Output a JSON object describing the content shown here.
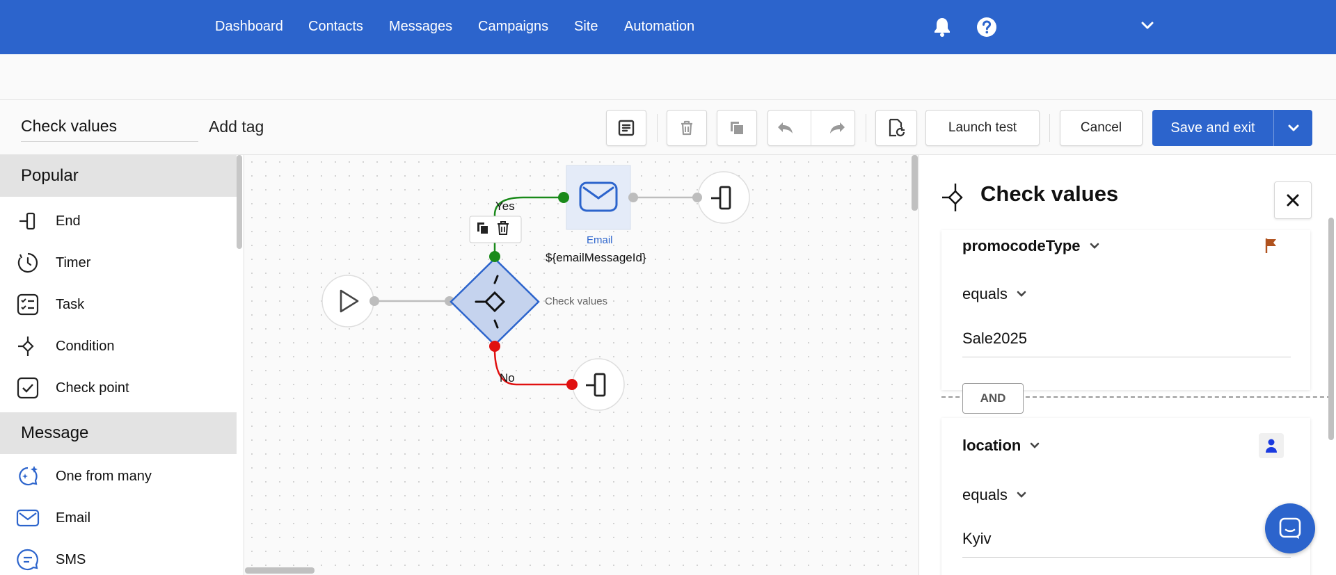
{
  "nav": {
    "items": [
      "Dashboard",
      "Contacts",
      "Messages",
      "Campaigns",
      "Site",
      "Automation"
    ]
  },
  "toolbar": {
    "name_value": "Check values",
    "tag_value": "Add tag",
    "launch_test_label": "Launch test",
    "cancel_label": "Cancel",
    "save_label": "Save and exit"
  },
  "palette": {
    "sections": [
      {
        "title": "Popular",
        "items": [
          "End",
          "Timer",
          "Task",
          "Condition",
          "Check point"
        ]
      },
      {
        "title": "Message",
        "items": [
          "One from many",
          "Email",
          "SMS"
        ]
      }
    ]
  },
  "canvas": {
    "yes_label": "Yes",
    "no_label": "No",
    "email_node_label": "Email",
    "email_node_var": "${emailMessageId}",
    "condition_node_label": "Check values"
  },
  "panel": {
    "title": "Check values",
    "conditions": [
      {
        "field": "promocodeType",
        "operator": "equals",
        "value": "Sale2025"
      },
      {
        "field": "location",
        "operator": "equals",
        "value": "Kyiv"
      }
    ],
    "joiner": "AND"
  },
  "colors": {
    "brand": "#2c64cc",
    "yes": "#1a8a1a",
    "no": "#e01010",
    "flag": "#b0521e",
    "person": "#1a3ae0"
  }
}
